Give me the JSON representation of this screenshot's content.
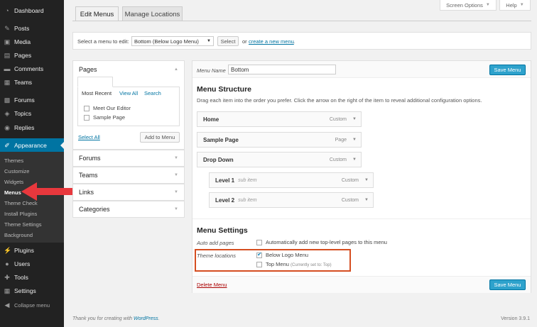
{
  "sidebar": {
    "items": [
      {
        "label": "Dashboard",
        "icon": "dashboard-icon",
        "glyph": "◔"
      },
      {
        "label": "Posts",
        "icon": "pin-icon",
        "glyph": "✎"
      },
      {
        "label": "Media",
        "icon": "media-icon",
        "glyph": "▣"
      },
      {
        "label": "Pages",
        "icon": "pages-icon",
        "glyph": "▤"
      },
      {
        "label": "Comments",
        "icon": "comments-icon",
        "glyph": "▬"
      },
      {
        "label": "Teams",
        "icon": "teams-icon",
        "glyph": "▦"
      },
      {
        "label": "Forums",
        "icon": "forums-icon",
        "glyph": "▩"
      },
      {
        "label": "Topics",
        "icon": "topics-icon",
        "glyph": "◈"
      },
      {
        "label": "Replies",
        "icon": "replies-icon",
        "glyph": "◉"
      },
      {
        "label": "Appearance",
        "icon": "appearance-icon",
        "glyph": "✐"
      },
      {
        "label": "Plugins",
        "icon": "plugins-icon",
        "glyph": "⚡"
      },
      {
        "label": "Users",
        "icon": "users-icon",
        "glyph": "●"
      },
      {
        "label": "Tools",
        "icon": "tools-icon",
        "glyph": "✚"
      },
      {
        "label": "Settings",
        "icon": "settings-icon",
        "glyph": "▦"
      },
      {
        "label": "Collapse menu",
        "icon": "collapse-icon",
        "glyph": "◀"
      }
    ],
    "submenu": [
      "Themes",
      "Customize",
      "Widgets",
      "Menus",
      "Theme Check",
      "Install Plugins",
      "Theme Settings",
      "Background"
    ]
  },
  "top": {
    "screen_options": "Screen Options",
    "help": "Help",
    "tabs": [
      "Edit Menus",
      "Manage Locations"
    ]
  },
  "select_bar": {
    "label": "Select a menu to edit:",
    "selected": "Bottom (Below Logo Menu)",
    "select_button": "Select",
    "or_text": "or",
    "create_link": "create a new menu",
    "period": "."
  },
  "left_panel": {
    "pages_title": "Pages",
    "inner_tabs": [
      "Most Recent",
      "View All",
      "Search"
    ],
    "pages": [
      "Meet Our Editor",
      "Sample Page"
    ],
    "select_all": "Select All",
    "add_button": "Add to Menu",
    "sections": [
      "Forums",
      "Teams",
      "Links",
      "Categories"
    ]
  },
  "editor": {
    "menu_name_label": "Menu Name",
    "menu_name_value": "Bottom",
    "save_button": "Save Menu",
    "structure_title": "Menu Structure",
    "structure_hint": "Drag each item into the order you prefer. Click the arrow on the right of the item to reveal additional configuration options.",
    "items": [
      {
        "title": "Home",
        "type": "Custom",
        "sub": ""
      },
      {
        "title": "Sample Page",
        "type": "Page",
        "sub": ""
      },
      {
        "title": "Drop Down",
        "type": "Custom",
        "sub": ""
      },
      {
        "title": "Level 1",
        "type": "Custom",
        "sub": "sub item"
      },
      {
        "title": "Level 2",
        "type": "Custom",
        "sub": "sub item"
      }
    ],
    "settings_title": "Menu Settings",
    "auto_add_label": "Auto add pages",
    "auto_add_text": "Automatically add new top-level pages to this menu",
    "theme_locations_label": "Theme locations",
    "locations": [
      {
        "label": "Below Logo Menu",
        "note": "",
        "checked": true
      },
      {
        "label": "Top Menu",
        "note": "(Currently set to: Top)",
        "checked": false
      }
    ],
    "delete_link": "Delete Menu"
  },
  "footer": {
    "thanks_prefix": "Thank you for creating with ",
    "wp_link": "WordPress",
    "thanks_suffix": ".",
    "version": "Version 3.9.1"
  },
  "colors": {
    "accent": "#0074a2",
    "highlight_box": "#d54e21",
    "arrow": "#e8383d"
  }
}
